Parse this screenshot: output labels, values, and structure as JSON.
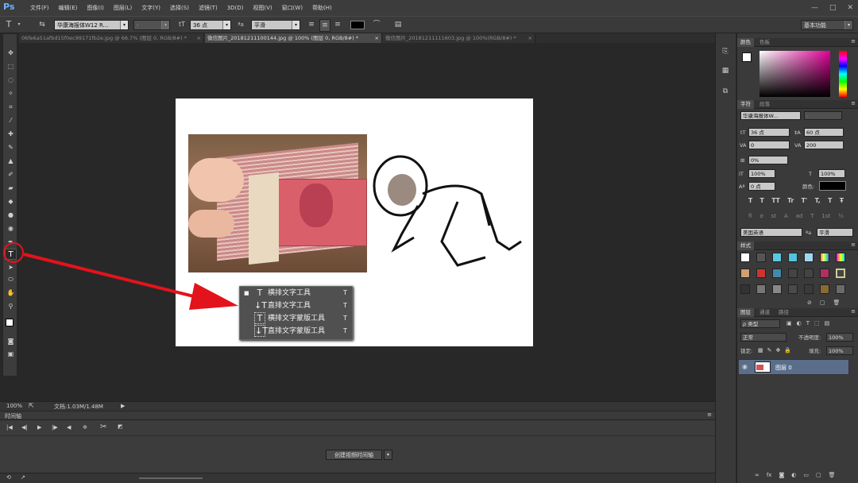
{
  "app": {
    "logo": "Ps"
  },
  "menu": [
    "文件(F)",
    "编辑(E)",
    "图像(I)",
    "图层(L)",
    "文字(Y)",
    "选择(S)",
    "滤镜(T)",
    "3D(D)",
    "视图(V)",
    "窗口(W)",
    "帮助(H)"
  ],
  "window_controls": {
    "minimize": "—",
    "maximize": "□",
    "close": "✕"
  },
  "options": {
    "font_family": "华康海报体W12 R...",
    "font_style": "-",
    "font_size": "36 点",
    "aa_mode": "平滑",
    "workspace": "基本功能",
    "aa_label": "ªa",
    "size_icon": "tT",
    "tool_icon": "T"
  },
  "tabs": [
    {
      "label": "06fe6a51afbd15f0ec99171fb2e.jpg @ 66.7% (图层 0, RGB/8#) *",
      "close": "×"
    },
    {
      "label": "微信图片_20181211100144.jpg @ 100% (图层 0, RGB/8#) *",
      "close": "×"
    },
    {
      "label": "微信图片_20181211111603.jpg @ 100%(RGB/8#) *",
      "close": "×"
    }
  ],
  "flyout": {
    "items": [
      {
        "glyph": "T",
        "label": "横排文字工具",
        "shortcut": "T",
        "selected": "■"
      },
      {
        "glyph": "↓T",
        "label": "直排文字工具",
        "shortcut": "T",
        "selected": ""
      },
      {
        "glyph": "T",
        "label": "横排文字蒙版工具",
        "shortcut": "T",
        "selected": ""
      },
      {
        "glyph": "↓T",
        "label": "直排文字蒙版工具",
        "shortcut": "T",
        "selected": ""
      }
    ]
  },
  "status": {
    "zoom": "100%",
    "doc": "文档:1.03M/1.48M",
    "arrow": "▶"
  },
  "timeline": {
    "title": "时间轴",
    "create_button": "创建视频时间轴"
  },
  "panels": {
    "color": {
      "tabs": [
        "颜色",
        "色板"
      ]
    },
    "character": {
      "tabs": [
        "字符",
        "段落"
      ],
      "font": "华康海报体W...",
      "style": "-",
      "size": "36 点",
      "leading": "60 点",
      "kerning": "0",
      "tracking": "200",
      "scale": "0%",
      "vscale": "100%",
      "hscale": "100%",
      "baseline": "0 点",
      "color_label": "颜色:",
      "styles_row1": [
        "T",
        "T",
        "TT",
        "Tr",
        "T'",
        "T,",
        "T",
        "Ŧ"
      ],
      "styles_row2": [
        "fi",
        "σ",
        "st",
        "A",
        "ad",
        "T",
        "1st",
        "½"
      ],
      "language": "美国英语",
      "aa_label": "ªa",
      "aa": "平滑"
    },
    "styles": {
      "tab": "样式"
    },
    "layers": {
      "tabs": [
        "图层",
        "通道",
        "路径"
      ],
      "filter": "ρ 类型",
      "blend": "正常",
      "opacity_label": "不透明度:",
      "opacity": "100%",
      "lock_label": "锁定:",
      "fill_label": "填充:",
      "fill": "100%",
      "layer_name": "图层 0"
    }
  },
  "colors": {
    "accent_red": "#e3131b",
    "fg_color": "#000000",
    "layer_selected": "#5a6e8c"
  }
}
